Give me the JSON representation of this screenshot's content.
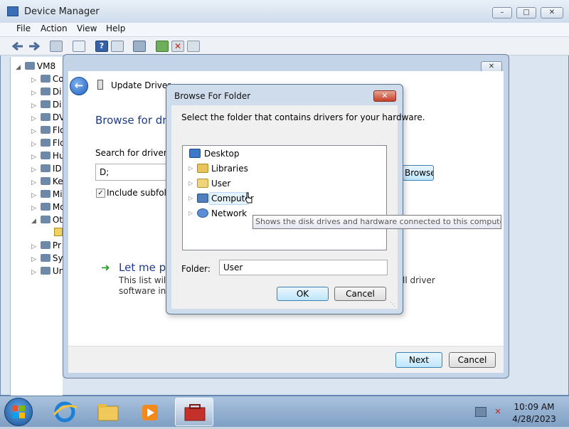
{
  "device_manager": {
    "title": "Device Manager",
    "menu": [
      "File",
      "Action",
      "View",
      "Help"
    ],
    "tree_root": "VM8",
    "tree_items": [
      "Co",
      "Di",
      "Di",
      "DV",
      "Flo",
      "Flo",
      "Hu",
      "ID",
      "Ke",
      "Mi",
      "Mo",
      "Ot",
      "Pr",
      "Sy",
      "Un"
    ]
  },
  "update_driver": {
    "header": "Update Driver Software",
    "heading": "Browse for driver software",
    "search_label": "Search for driver software in this location:",
    "path_value": "D;",
    "browse_button": "Browse...",
    "include_subfolders": "Include subfolders",
    "let_me_pick": "Let me pick from a list",
    "desc_line1_start": "This list will show",
    "desc_line1_end": "ll driver",
    "desc_line2": "software in the",
    "next_button": "Next",
    "cancel_button": "Cancel"
  },
  "browse_folder": {
    "title": "Browse For Folder",
    "instruction": "Select the folder that contains drivers for your hardware.",
    "tree": [
      {
        "label": "Desktop"
      },
      {
        "label": "Libraries"
      },
      {
        "label": "User"
      },
      {
        "label": "Computer"
      },
      {
        "label": "Network"
      }
    ],
    "tooltip": "Shows the disk drives and hardware connected to this computer.",
    "folder_label": "Folder:",
    "folder_value": "User",
    "ok_button": "OK",
    "cancel_button": "Cancel"
  },
  "taskbar": {
    "time": "10:09 AM",
    "date": "4/28/2023"
  },
  "colors": {
    "link_blue": "#1e3a8a",
    "selection_bg": "#e5f3fb",
    "close_red": "#c4402b"
  }
}
